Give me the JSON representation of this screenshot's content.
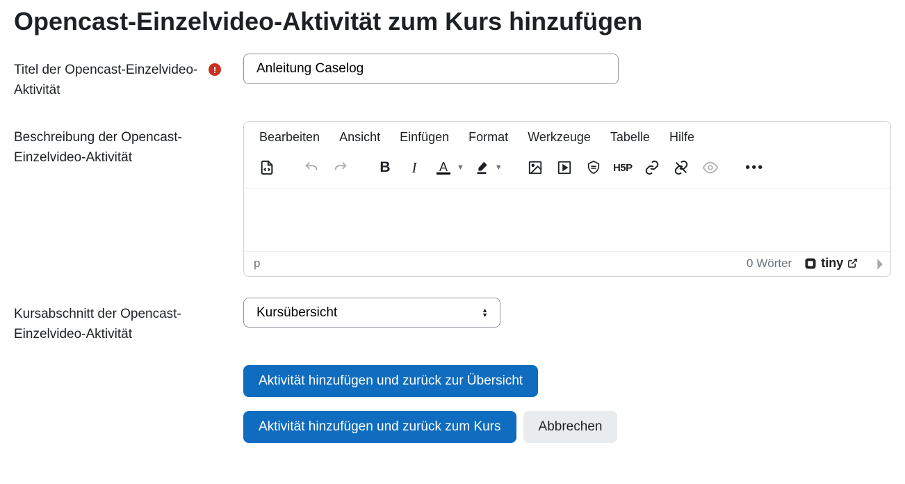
{
  "heading": "Opencast-Einzelvideo-Aktivität zum Kurs hinzufügen",
  "fields": {
    "title": {
      "label": "Titel der Opencast-Einzelvideo-Aktivität",
      "value": "Anleitung Caselog",
      "required_mark": "!"
    },
    "description": {
      "label": "Beschreibung der Opencast-Einzelvideo-Aktivität"
    },
    "section": {
      "label": "Kursabschnitt der Opencast-Einzelvideo-Aktivität",
      "selected": "Kursübersicht",
      "options": [
        "Kursübersicht"
      ]
    }
  },
  "editor": {
    "menus": {
      "edit": "Bearbeiten",
      "view": "Ansicht",
      "insert": "Einfügen",
      "format": "Format",
      "tools": "Werkzeuge",
      "table": "Tabelle",
      "help": "Hilfe"
    },
    "status_path": "p",
    "word_count": "0 Wörter",
    "brand": "tiny"
  },
  "buttons": {
    "add_return_overview": "Aktivität hinzufügen und zurück zur Übersicht",
    "add_return_course": "Aktivität hinzufügen und zurück zum Kurs",
    "cancel": "Abbrechen"
  }
}
